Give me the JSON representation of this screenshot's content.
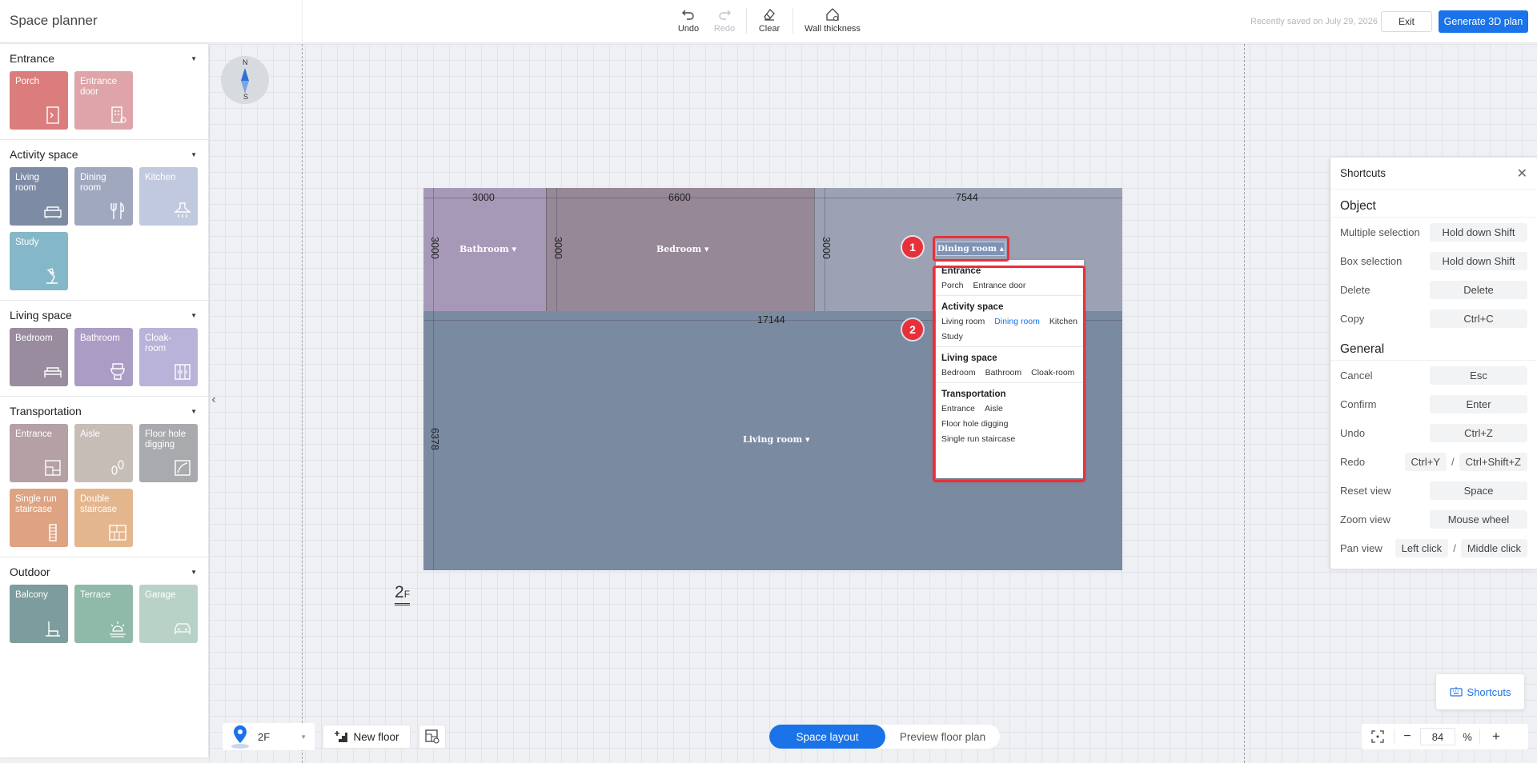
{
  "app": {
    "title": "Space planner"
  },
  "toolbar": {
    "undo": "Undo",
    "redo": "Redo",
    "clear": "Clear",
    "wall_thickness": "Wall thickness",
    "saved_text": "Recently saved on July 29, 2026",
    "exit": "Exit",
    "generate": "Generate 3D plan"
  },
  "sidebar": {
    "categories": [
      {
        "title": "Entrance",
        "items": [
          {
            "label": "Porch",
            "icon": "door-icon",
            "color": "#dc7d7d"
          },
          {
            "label": "Entrance door",
            "icon": "keypad-lock-icon",
            "color": "#dea4a7"
          }
        ]
      },
      {
        "title": "Activity space",
        "items": [
          {
            "label": "Living room",
            "icon": "sofa-icon",
            "color": "#7e8ba4"
          },
          {
            "label": "Dining room",
            "icon": "fork-knife-icon",
            "color": "#a0a8bf"
          },
          {
            "label": "Kitchen",
            "icon": "range-hood-icon",
            "color": "#c1c9de"
          },
          {
            "label": "Study",
            "icon": "desk-lamp-icon",
            "color": "#84b8c9"
          }
        ]
      },
      {
        "title": "Living space",
        "items": [
          {
            "label": "Bedroom",
            "icon": "bed-icon",
            "color": "#9a8c9f"
          },
          {
            "label": "Bathroom",
            "icon": "toilet-icon",
            "color": "#ab9cc6"
          },
          {
            "label": "Cloak-room",
            "icon": "wardrobe-icon",
            "color": "#b9b3da"
          }
        ]
      },
      {
        "title": "Transportation",
        "items": [
          {
            "label": "Entrance",
            "icon": "entrance-icon",
            "color": "#b5a0a5"
          },
          {
            "label": "Aisle",
            "icon": "footprints-icon",
            "color": "#c6bdb7"
          },
          {
            "label": "Floor hole digging",
            "icon": "floor-hole-icon",
            "color": "#a8aaad"
          },
          {
            "label": "Single run staircase",
            "icon": "single-stair-icon",
            "color": "#dea382"
          },
          {
            "label": "Double staircase",
            "icon": "double-stair-icon",
            "color": "#e4b68e"
          }
        ]
      },
      {
        "title": "Outdoor",
        "items": [
          {
            "label": "Balcony",
            "icon": "balcony-chair-icon",
            "color": "#7d9c9d"
          },
          {
            "label": "Terrace",
            "icon": "sun-icon",
            "color": "#8fb9a9"
          },
          {
            "label": "Garage",
            "icon": "car-icon",
            "color": "#b9d2c8"
          }
        ]
      }
    ]
  },
  "compass": {
    "north": "N",
    "south": "S"
  },
  "plan": {
    "floor_label": "2",
    "floor_suffix": "F",
    "rooms": {
      "bathroom": "Bathroom",
      "bedroom": "Bedroom",
      "dining": "Dining room",
      "living": "Living room"
    },
    "dims": {
      "top1": "3000",
      "top2": "6600",
      "top3": "7544",
      "left1": "3000",
      "left2": "3000",
      "left3": "3000",
      "middle": "17144",
      "living_height": "6378"
    },
    "colors": {
      "bathroom": "#a699b7",
      "bedroom": "#968896",
      "dining": "#9ca2b4",
      "living": "#7a8aa0"
    }
  },
  "annotations": {
    "badge1": "1",
    "badge2": "2"
  },
  "dropdown_menu": {
    "groups": [
      {
        "title": "Entrance",
        "items": [
          "Porch",
          "Entrance door"
        ]
      },
      {
        "title": "Activity space",
        "items": [
          "Living room",
          "Dining room",
          "Kitchen",
          "Study"
        ]
      },
      {
        "title": "Living space",
        "items": [
          "Bedroom",
          "Bathroom",
          "Cloak-room"
        ]
      },
      {
        "title": "Transportation",
        "items": [
          "Entrance",
          "Aisle",
          "Floor hole digging",
          "Single run staircase"
        ]
      }
    ],
    "selected": "Dining room"
  },
  "shortcuts": {
    "title": "Shortcuts",
    "object_title": "Object",
    "general_title": "General",
    "object": [
      {
        "label": "Multiple selection",
        "keys": [
          "Hold down Shift"
        ]
      },
      {
        "label": "Box selection",
        "keys": [
          "Hold down Shift"
        ]
      },
      {
        "label": "Delete",
        "keys": [
          "Delete"
        ]
      },
      {
        "label": "Copy",
        "keys": [
          "Ctrl+C"
        ]
      }
    ],
    "general": [
      {
        "label": "Cancel",
        "keys": [
          "Esc"
        ]
      },
      {
        "label": "Confirm",
        "keys": [
          "Enter"
        ]
      },
      {
        "label": "Undo",
        "keys": [
          "Ctrl+Z"
        ]
      },
      {
        "label": "Redo",
        "keys": [
          "Ctrl+Y",
          "Ctrl+Shift+Z"
        ]
      },
      {
        "label": "Reset view",
        "keys": [
          "Space"
        ]
      },
      {
        "label": "Zoom view",
        "keys": [
          "Mouse wheel"
        ]
      },
      {
        "label": "Pan view",
        "keys": [
          "Left click",
          "Middle click"
        ]
      }
    ],
    "float_button": "Shortcuts"
  },
  "bottom": {
    "floor_select": "2F",
    "new_floor": "New floor",
    "mode_active": "Space layout",
    "mode_inactive": "Preview floor plan",
    "zoom_value": "84",
    "zoom_unit": "%",
    "zoom_minus": "−",
    "zoom_plus": "+"
  }
}
